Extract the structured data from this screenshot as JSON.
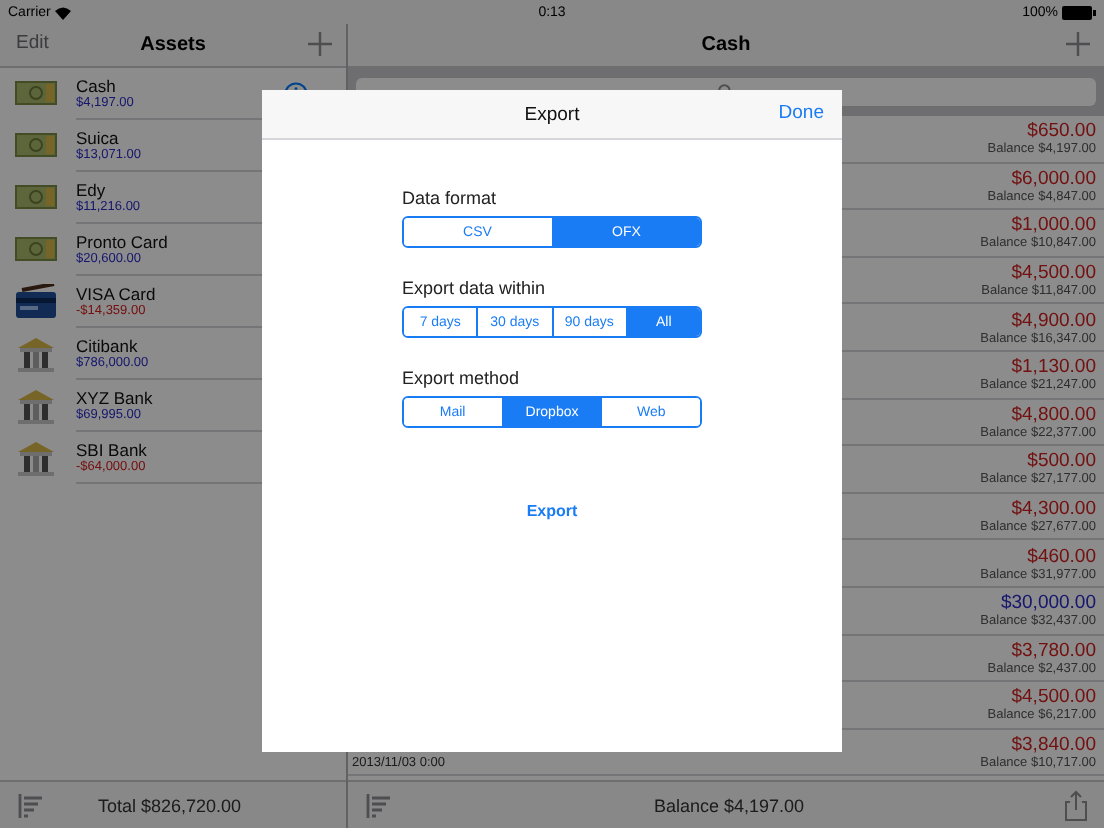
{
  "status_bar": {
    "carrier": "Carrier",
    "time": "0:13",
    "battery": "100%"
  },
  "assets_pane": {
    "edit": "Edit",
    "title": "Assets",
    "accounts": [
      {
        "name": "Cash",
        "amount": "$4,197.00",
        "kind": "cash",
        "negative": false
      },
      {
        "name": "Suica",
        "amount": "$13,071.00",
        "kind": "cash",
        "negative": false
      },
      {
        "name": "Edy",
        "amount": "$11,216.00",
        "kind": "cash",
        "negative": false
      },
      {
        "name": "Pronto Card",
        "amount": "$20,600.00",
        "kind": "cash",
        "negative": false
      },
      {
        "name": "VISA Card",
        "amount": "-$14,359.00",
        "kind": "card",
        "negative": true
      },
      {
        "name": "Citibank",
        "amount": "$786,000.00",
        "kind": "bank",
        "negative": false
      },
      {
        "name": "XYZ Bank",
        "amount": "$69,995.00",
        "kind": "bank",
        "negative": false
      },
      {
        "name": "SBI Bank",
        "amount": "-$64,000.00",
        "kind": "bank",
        "negative": true
      }
    ],
    "total": "Total $826,720.00"
  },
  "cash_pane": {
    "title": "Cash",
    "transactions": [
      {
        "amount": "$650.00",
        "balance": "Balance $4,197.00",
        "kind": "expense"
      },
      {
        "amount": "$6,000.00",
        "balance": "Balance $4,847.00",
        "kind": "expense"
      },
      {
        "amount": "$1,000.00",
        "balance": "Balance $10,847.00",
        "kind": "expense"
      },
      {
        "amount": "$4,500.00",
        "balance": "Balance $11,847.00",
        "kind": "expense"
      },
      {
        "amount": "$4,900.00",
        "balance": "Balance $16,347.00",
        "kind": "expense"
      },
      {
        "amount": "$1,130.00",
        "balance": "Balance $21,247.00",
        "kind": "expense"
      },
      {
        "amount": "$4,800.00",
        "balance": "Balance $22,377.00",
        "kind": "expense"
      },
      {
        "amount": "$500.00",
        "balance": "Balance $27,177.00",
        "kind": "expense"
      },
      {
        "amount": "$4,300.00",
        "balance": "Balance $27,677.00",
        "kind": "expense"
      },
      {
        "amount": "$460.00",
        "balance": "Balance $31,977.00",
        "kind": "expense"
      },
      {
        "amount": "$30,000.00",
        "balance": "Balance $32,437.00",
        "kind": "income"
      },
      {
        "amount": "$3,780.00",
        "balance": "Balance $2,437.00",
        "kind": "expense"
      },
      {
        "amount": "$4,500.00",
        "balance": "Balance $6,217.00",
        "kind": "expense"
      },
      {
        "amount": "$3,840.00",
        "balance": "Balance $10,717.00",
        "kind": "expense",
        "date": "2013/11/03 0:00"
      }
    ],
    "balance": "Balance $4,197.00"
  },
  "export_dialog": {
    "title": "Export",
    "done": "Done",
    "sections": [
      {
        "label": "Data format",
        "options": [
          {
            "label": "CSV",
            "selected": false
          },
          {
            "label": "OFX",
            "selected": true
          }
        ]
      },
      {
        "label": "Export data within",
        "options": [
          {
            "label": "7 days",
            "selected": false
          },
          {
            "label": "30 days",
            "selected": false
          },
          {
            "label": "90 days",
            "selected": false
          },
          {
            "label": "All",
            "selected": true
          }
        ]
      },
      {
        "label": "Export method",
        "options": [
          {
            "label": "Mail",
            "selected": false
          },
          {
            "label": "Dropbox",
            "selected": true
          },
          {
            "label": "Web",
            "selected": false
          }
        ]
      }
    ],
    "export_button": "Export"
  }
}
